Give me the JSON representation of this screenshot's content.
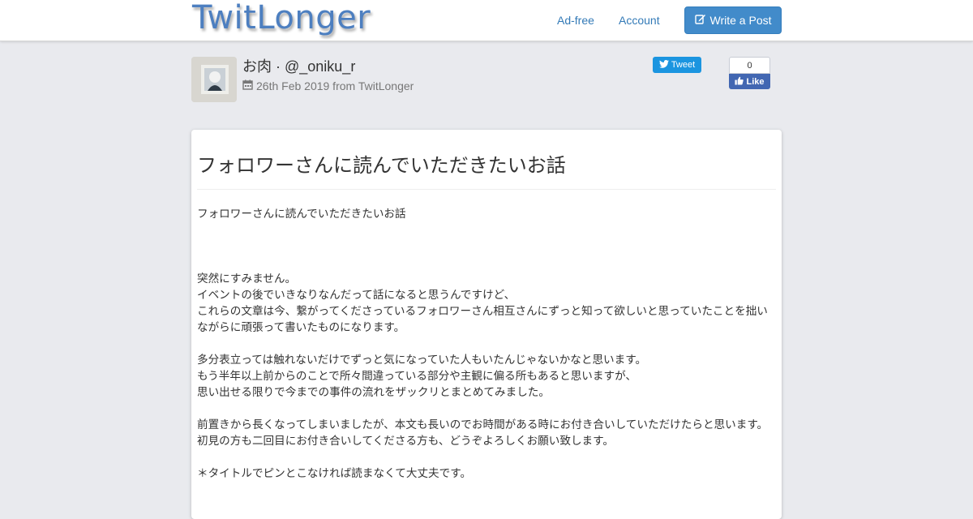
{
  "navbar": {
    "brand": "TwitLonger",
    "links": [
      {
        "label": "Ad-free"
      },
      {
        "label": "Account"
      }
    ],
    "write_button": {
      "label": "Write a Post",
      "icon": "edit-icon"
    }
  },
  "author": {
    "display": "お肉 · @_oniku_r",
    "date_line": "26th Feb 2019 from TwitLonger",
    "date_icon": "calendar-icon"
  },
  "share": {
    "tweet_label": "Tweet",
    "like_count": "0",
    "like_label": "Like"
  },
  "post": {
    "title": "フォロワーさんに読んでいただきたいお話",
    "lines": [
      "フォロワーさんに読んでいただきたいお話",
      "",
      "",
      "",
      "突然にすみません。",
      "イベントの後でいきなりなんだって話になると思うんですけど、",
      "これらの文章は今、繋がってくださっているフォロワーさん相互さんにずっと知って欲しいと思っていたことを拙いながらに頑張って書いたものになります。",
      "",
      "多分表立っては触れないだけでずっと気になっていた人もいたんじゃないかなと思います。",
      "もう半年以上前からのことで所々間違っている部分や主観に偏る所もあると思いますが、",
      "思い出せる限りで今までの事件の流れをザックリとまとめてみました。",
      "",
      "前置きから長くなってしまいましたが、本文も長いのでお時間がある時にお付き合いしていただけたらと思います。",
      "初見の方も二回目にお付き合いしてくださる方も、どうぞよろしくお願い致します。",
      "",
      "＊タイトルでピンとこなければ読まなくて大丈夫です。"
    ]
  },
  "colors": {
    "brand": "#4d7fc0",
    "primary_button": "#428bca",
    "link": "#337ab7",
    "tweet": "#1b95e0",
    "like": "#4267b2",
    "page_background": "#e9eaee"
  }
}
